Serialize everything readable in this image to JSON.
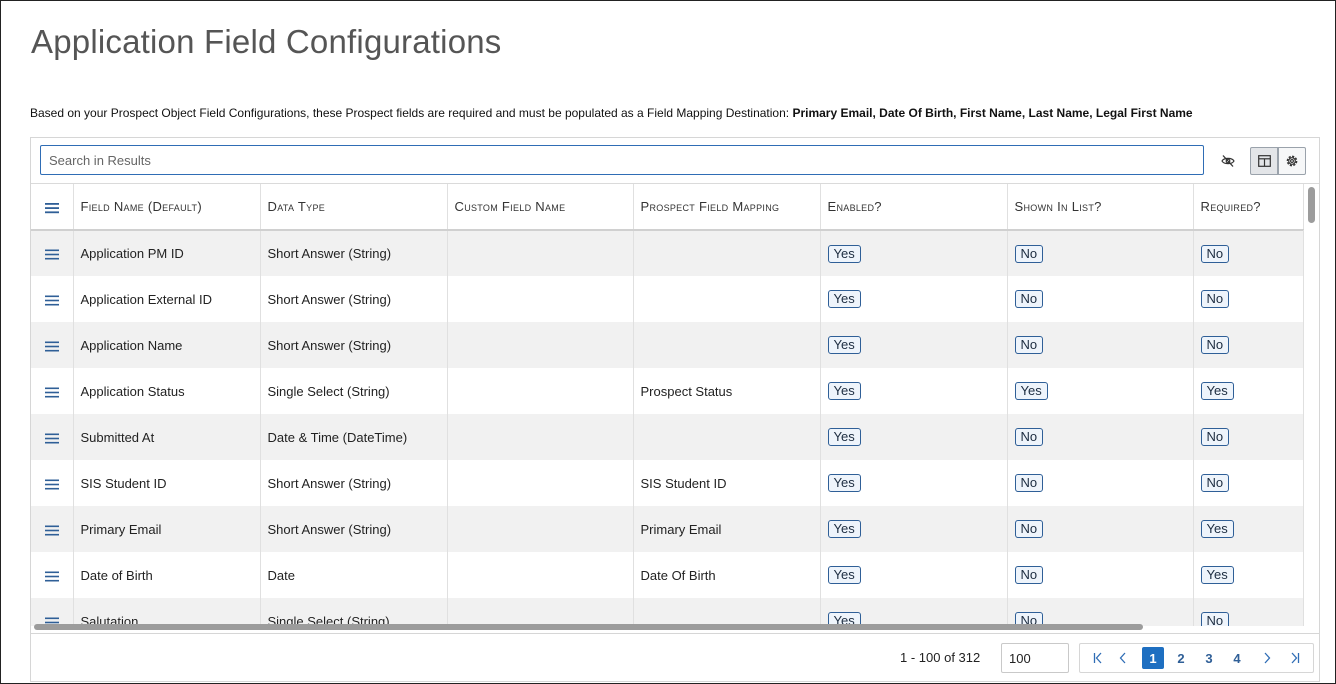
{
  "page": {
    "title": "Application Field Configurations",
    "notice_prefix": "Based on your Prospect Object Field Configurations, these Prospect fields are required and must be populated as a Field Mapping Destination:",
    "notice_fields": "Primary Email, Date Of Birth, First Name, Last Name, Legal First Name"
  },
  "toolbar": {
    "search_placeholder": "Search in Results",
    "hide_icon": "eye-off-icon",
    "columns_icon": "columns-icon",
    "settings_icon": "gear-icon"
  },
  "table": {
    "headers": [
      "Field Name (Default)",
      "Data Type",
      "Custom Field Name",
      "Prospect Field Mapping",
      "Enabled?",
      "Shown In List?",
      "Required?"
    ],
    "rows": [
      {
        "field": "Application PM ID",
        "type": "Short Answer (String)",
        "custom": "",
        "mapping": "",
        "enabled": "Yes",
        "shown": "No",
        "required": "No"
      },
      {
        "field": "Application External ID",
        "type": "Short Answer (String)",
        "custom": "",
        "mapping": "",
        "enabled": "Yes",
        "shown": "No",
        "required": "No"
      },
      {
        "field": "Application Name",
        "type": "Short Answer (String)",
        "custom": "",
        "mapping": "",
        "enabled": "Yes",
        "shown": "No",
        "required": "No"
      },
      {
        "field": "Application Status",
        "type": "Single Select (String)",
        "custom": "",
        "mapping": "Prospect Status",
        "enabled": "Yes",
        "shown": "Yes",
        "required": "Yes"
      },
      {
        "field": "Submitted At",
        "type": "Date & Time (DateTime)",
        "custom": "",
        "mapping": "",
        "enabled": "Yes",
        "shown": "No",
        "required": "No"
      },
      {
        "field": "SIS Student ID",
        "type": "Short Answer (String)",
        "custom": "",
        "mapping": "SIS Student ID",
        "enabled": "Yes",
        "shown": "No",
        "required": "No"
      },
      {
        "field": "Primary Email",
        "type": "Short Answer (String)",
        "custom": "",
        "mapping": "Primary Email",
        "enabled": "Yes",
        "shown": "No",
        "required": "Yes"
      },
      {
        "field": "Date of Birth",
        "type": "Date",
        "custom": "",
        "mapping": "Date Of Birth",
        "enabled": "Yes",
        "shown": "No",
        "required": "Yes"
      },
      {
        "field": "Salutation",
        "type": "Single Select (String)",
        "custom": "",
        "mapping": "",
        "enabled": "Yes",
        "shown": "No",
        "required": "No"
      }
    ]
  },
  "footer": {
    "range": "1 - 100 of 312",
    "page_size": "100",
    "pages": [
      "1",
      "2",
      "3",
      "4"
    ],
    "current_page": "1"
  },
  "colors": {
    "accent": "#1e6fc1",
    "badge_border": "#2f5f97",
    "row_alt": "#f1f1f1"
  }
}
